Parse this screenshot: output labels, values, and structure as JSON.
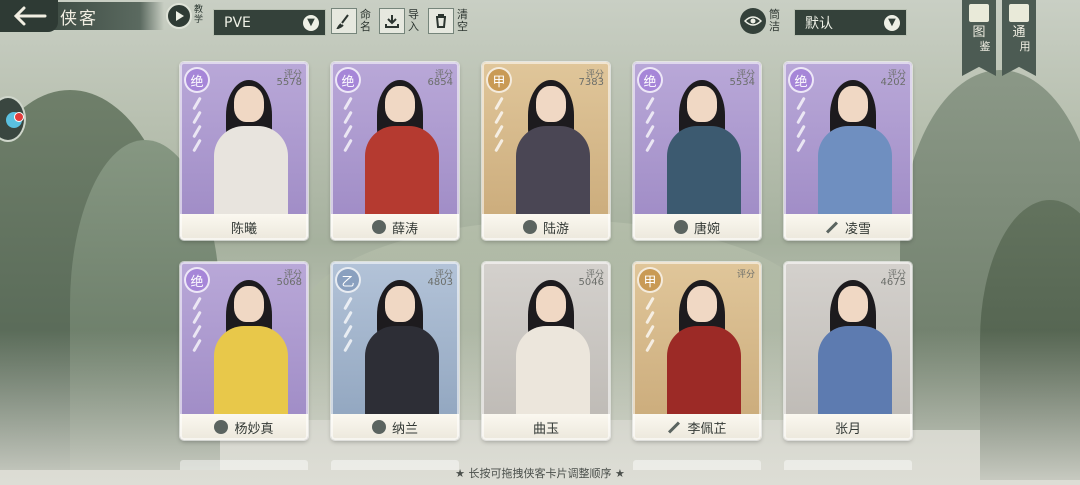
{
  "header": {
    "title": "侠客",
    "tutorial_label": "教学",
    "mode_value": "PVE",
    "rename_label": "命名",
    "import_label": "导入",
    "clear_label": "清空",
    "filter_label": "筒洁",
    "sort_value": "默认",
    "atlas_label_1": "图",
    "atlas_label_2": "鉴",
    "general_label_1": "通",
    "general_label_2": "用"
  },
  "cards": [
    {
      "name": "陈曦",
      "rank": "绝",
      "score_label": "评分",
      "score": "5578",
      "tier": "violet",
      "icon": "none",
      "body": "#e8e4de"
    },
    {
      "name": "薛涛",
      "rank": "绝",
      "score_label": "评分",
      "score": "6854",
      "tier": "violet",
      "icon": "lotus",
      "body": "#b53a30"
    },
    {
      "name": "陆游",
      "rank": "甲",
      "score_label": "评分",
      "score": "7383",
      "tier": "gold",
      "icon": "lotus",
      "body": "#4a4654"
    },
    {
      "name": "唐婉",
      "rank": "绝",
      "score_label": "评分",
      "score": "5534",
      "tier": "violet",
      "icon": "lotus",
      "body": "#3c5a70"
    },
    {
      "name": "凌雪",
      "rank": "绝",
      "score_label": "评分",
      "score": "4202",
      "tier": "violet",
      "icon": "sword",
      "body": "#6f8fc0"
    },
    {
      "name": "杨妙真",
      "rank": "绝",
      "score_label": "评分",
      "score": "5068",
      "tier": "violet",
      "icon": "lotus",
      "body": "#e8c84a"
    },
    {
      "name": "纳兰",
      "rank": "乙",
      "score_label": "评分",
      "score": "4803",
      "tier": "blue",
      "icon": "lotus",
      "body": "#2d2e36"
    },
    {
      "name": "曲玉",
      "rank": "",
      "score_label": "评分",
      "score": "5046",
      "tier": "gray",
      "icon": "none",
      "body": "#ece6dc"
    },
    {
      "name": "李佩芷",
      "rank": "甲",
      "score_label": "评分",
      "score": "",
      "tier": "gold",
      "icon": "sword",
      "body": "#9c2a26"
    },
    {
      "name": "张月",
      "rank": "",
      "score_label": "评分",
      "score": "4675",
      "tier": "gray",
      "icon": "none",
      "body": "#5d7bb0"
    }
  ],
  "hint": "★ 长按可拖拽侠客卡片调整顺序 ★"
}
